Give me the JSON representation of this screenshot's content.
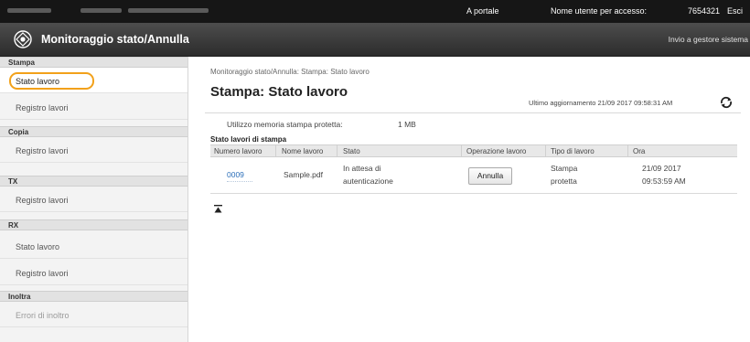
{
  "topbar": {
    "portal_link": "A portale",
    "login_label": "Nome utente per accesso:",
    "login_user": "7654321",
    "logout_link": "Esci"
  },
  "header": {
    "title": "Monitoraggio stato/Annulla",
    "send_link": "Invio a gestore sistema"
  },
  "sidebar": {
    "sections": [
      {
        "title": "Stampa",
        "items": [
          "Stato lavoro",
          "Registro lavori"
        ]
      },
      {
        "title": "Copia",
        "items": [
          "Registro lavori"
        ]
      },
      {
        "title": "TX",
        "items": [
          "Registro lavori"
        ]
      },
      {
        "title": "RX",
        "items": [
          "Stato lavoro",
          "Registro lavori"
        ]
      },
      {
        "title": "Inoltra",
        "items": [
          "Errori di inoltro"
        ]
      }
    ],
    "active_item": "Stato lavoro"
  },
  "main": {
    "breadcrumb": "Monitoraggio stato/Annulla: Stampa: Stato lavoro",
    "title": "Stampa: Stato lavoro",
    "last_update": "Ultimo aggiornamento 21/09 2017 09:58:31 AM",
    "memory_label": "Utilizzo memoria stampa protetta:",
    "memory_value": "1 MB",
    "table_caption": "Stato lavori di stampa",
    "columns": [
      "Numero lavoro",
      "Nome lavoro",
      "Stato",
      "Operazione lavoro",
      "Tipo di lavoro",
      "Ora"
    ],
    "rows": [
      {
        "job_number": "0009",
        "job_name": "Sample.pdf",
        "status_line1": "In attesa di",
        "status_line2": "autenticazione",
        "operation": "Annulla",
        "type_line1": "Stampa",
        "type_line2": "protetta",
        "time_line1": "21/09 2017",
        "time_line2": "09:53:59 AM"
      }
    ]
  },
  "colors": {
    "topbar": "#161616",
    "header": "#3c3c3c",
    "active_outline": "#f2a11a",
    "link": "#2c6fb9"
  }
}
